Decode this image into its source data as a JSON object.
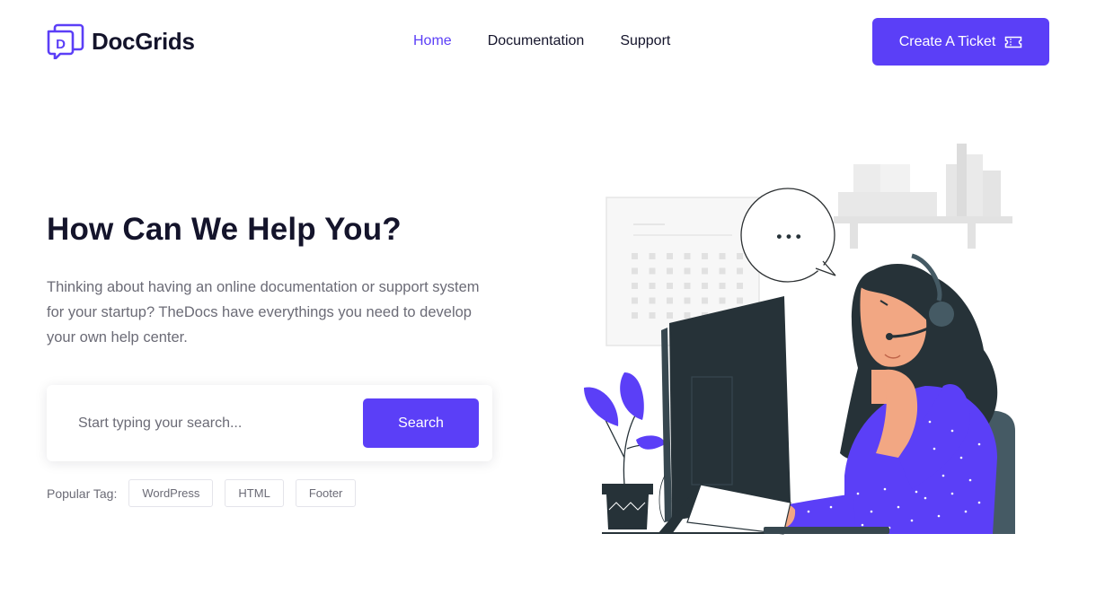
{
  "brand": {
    "name": "DocGrids",
    "logo_letter": "D"
  },
  "nav": {
    "items": [
      {
        "label": "Home",
        "active": true
      },
      {
        "label": "Documentation",
        "active": false
      },
      {
        "label": "Support",
        "active": false
      }
    ]
  },
  "header": {
    "cta_label": "Create A Ticket",
    "cta_icon": "ticket-icon"
  },
  "hero": {
    "title": "How Can We Help You?",
    "description": "Thinking about having an online documentation or support system for your startup? TheDocs have everythings you need to develop your own help center."
  },
  "search": {
    "placeholder": "Start typing your search...",
    "button_label": "Search"
  },
  "popular": {
    "label": "Popular Tag:",
    "tags": [
      "WordPress",
      "HTML",
      "Footer"
    ]
  },
  "colors": {
    "accent": "#5b3ff7",
    "text_dark": "#14142b",
    "text_muted": "#6b6b76"
  },
  "illustration": {
    "speech_bubble_text": "• • •"
  }
}
